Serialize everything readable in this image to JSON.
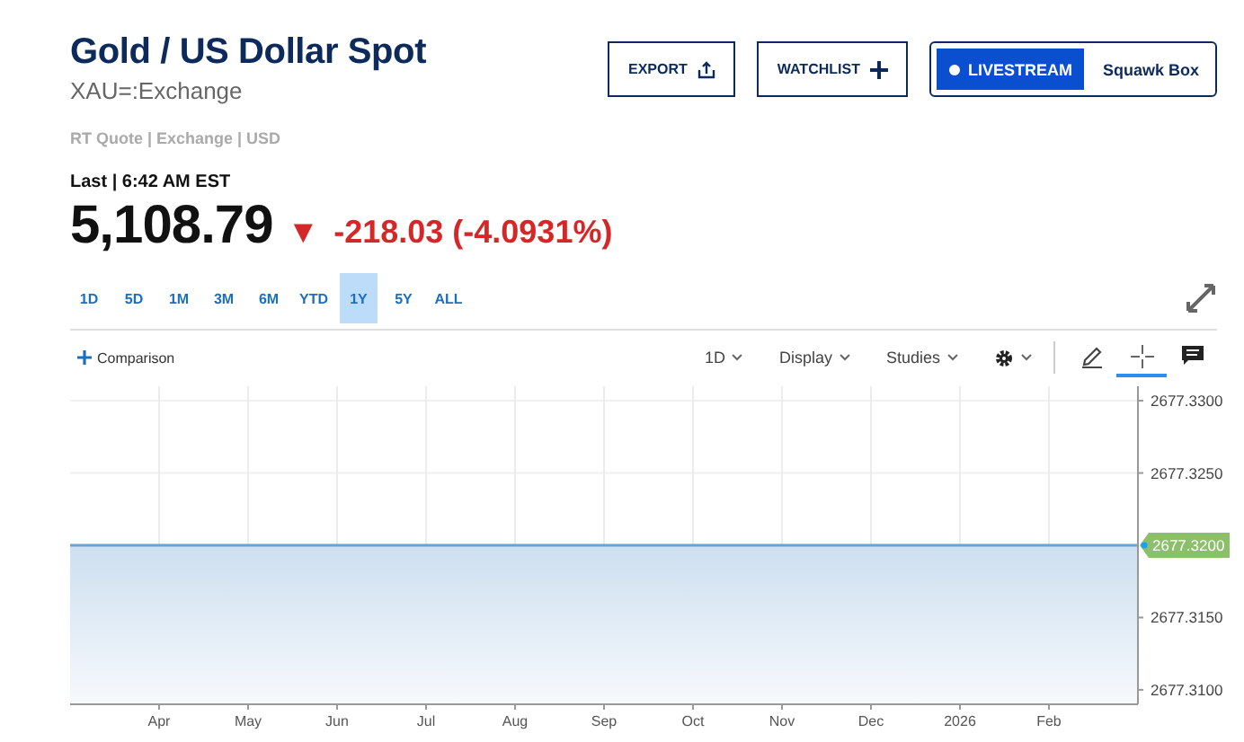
{
  "header": {
    "title": "Gold / US Dollar Spot",
    "symbol": "XAU=:Exchange",
    "quote_info": "RT Quote | Exchange | USD"
  },
  "actions": [
    {
      "label": "EXPORT",
      "kind": "export"
    },
    {
      "label": "WATCHLIST",
      "kind": "watchlist"
    }
  ],
  "livestream": {
    "label": "LIVESTREAM",
    "channel": "Squawk Box"
  },
  "quote": {
    "last_label": "Last | 6:42 AM EST",
    "price": "5,108.79",
    "arrow": "▼",
    "change": "-218.03 (-4.0931%)"
  },
  "ranges": [
    {
      "label": "1D",
      "selected": false
    },
    {
      "label": "5D",
      "selected": false
    },
    {
      "label": "1M",
      "selected": false
    },
    {
      "label": "3M",
      "selected": false
    },
    {
      "label": "6M",
      "selected": false
    },
    {
      "label": "YTD",
      "selected": false
    },
    {
      "label": "1Y",
      "selected": true
    },
    {
      "label": "5Y",
      "selected": false
    },
    {
      "label": "ALL",
      "selected": false
    }
  ],
  "toolbar": {
    "comparison": "Comparison",
    "dropdowns": [
      "1D",
      "Display",
      "Studies"
    ],
    "tools": [
      {
        "kind": "draw",
        "selected": false
      },
      {
        "kind": "crosshair",
        "selected": true
      },
      {
        "kind": "comment",
        "selected": false
      }
    ]
  },
  "chart": {
    "chart_data": {
      "type": "area",
      "grid": true,
      "ylim": [
        2677.309,
        2677.331
      ],
      "categories": [
        null,
        "Apr",
        "May",
        "Jun",
        "Jul",
        "Aug",
        "Sep",
        "Oct",
        "Nov",
        "Dec",
        "2026",
        "Feb",
        null
      ],
      "series": [
        {
          "color": "#6fa0d0",
          "values": [
            2677.32,
            2677.32,
            2677.32,
            2677.32,
            2677.32,
            2677.32,
            2677.32,
            2677.32,
            2677.32,
            2677.32,
            2677.32,
            2677.32,
            2677.32
          ]
        }
      ],
      "yticks": [
        {
          "value": 2677.33,
          "label": "2677.3300"
        },
        {
          "value": 2677.325,
          "label": "2677.3250"
        },
        {
          "value": 2677.32,
          "label": "2677.3200"
        },
        {
          "value": 2677.315,
          "label": "2677.3150"
        },
        {
          "value": 2677.31,
          "label": "2677.3100"
        }
      ]
    }
  }
}
